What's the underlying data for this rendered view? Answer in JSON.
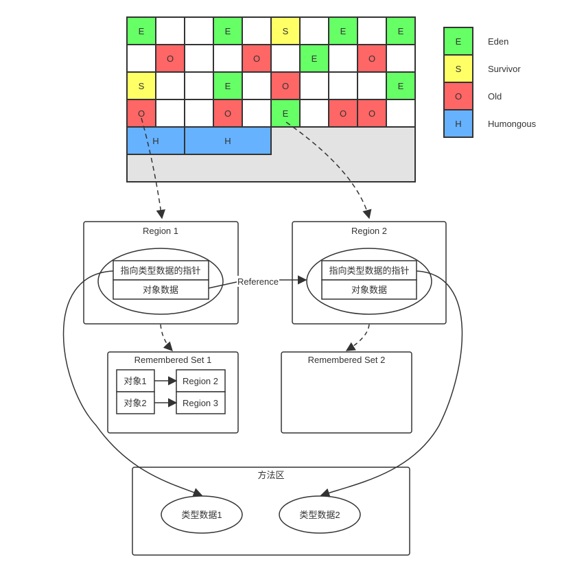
{
  "colors": {
    "E": "#66ff66",
    "S": "#ffff66",
    "O": "#ff6666",
    "H": "#66b2ff",
    "empty": "#ffffff",
    "unused": "#e3e3e3"
  },
  "heap_grid": {
    "rows": [
      [
        "E",
        "",
        "",
        "E",
        "",
        "S",
        "",
        "E",
        "",
        "E"
      ],
      [
        "",
        "O",
        "",
        "",
        "O",
        "",
        "E",
        "",
        "O",
        ""
      ],
      [
        "S",
        "",
        "",
        "E",
        "",
        "O",
        "",
        "",
        "",
        "E"
      ],
      [
        "O",
        "",
        "",
        "O",
        "",
        "E",
        "",
        "O",
        "O",
        ""
      ]
    ],
    "humongous": [
      {
        "label": "H",
        "span": 2
      },
      {
        "label": "H",
        "span": 3
      }
    ]
  },
  "legend": [
    {
      "key": "E",
      "label": "Eden"
    },
    {
      "key": "S",
      "label": "Survivor"
    },
    {
      "key": "O",
      "label": "Old"
    },
    {
      "key": "H",
      "label": "Humongous"
    }
  ],
  "region1": {
    "title": "Region 1",
    "pointer": "指向类型数据的指针",
    "object_data": "对象数据"
  },
  "region2": {
    "title": "Region 2",
    "pointer": "指向类型数据的指针",
    "object_data": "对象数据"
  },
  "reference_label": "Reference",
  "rset1": {
    "title": "Remembered Set 1",
    "entries": [
      {
        "object": "对象1",
        "region": "Region 2"
      },
      {
        "object": "对象2",
        "region": "Region 3"
      }
    ]
  },
  "rset2": {
    "title": "Remembered Set 2"
  },
  "method_area": {
    "title": "方法区",
    "type1": "类型数据1",
    "type2": "类型数据2"
  }
}
